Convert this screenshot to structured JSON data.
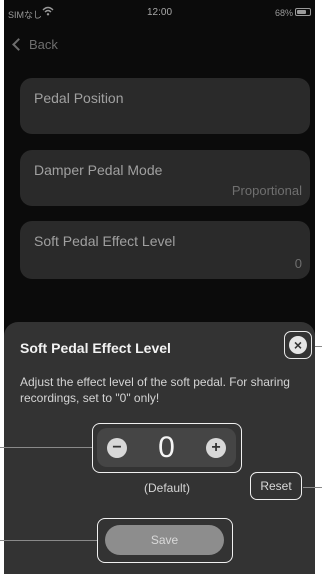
{
  "status_bar": {
    "carrier": "SIMなし",
    "time": "12:00",
    "battery_pct": "68%"
  },
  "nav": {
    "back_label": "Back"
  },
  "settings": [
    {
      "title": "Pedal Position",
      "value": ""
    },
    {
      "title": "Damper Pedal Mode",
      "value": "Proportional"
    },
    {
      "title": "Soft Pedal Effect Level",
      "value": "0"
    }
  ],
  "sheet": {
    "title": "Soft Pedal Effect Level",
    "description": "Adjust the effect level of the soft pedal. For sharing recordings, set to \"0\" only!",
    "stepper_value": "0",
    "default_label": "(Default)",
    "reset_label": "Reset",
    "save_label": "Save"
  },
  "icons": {
    "close": "close-icon",
    "minus": "minus-icon",
    "plus": "plus-icon",
    "back": "chevron-left-icon"
  }
}
